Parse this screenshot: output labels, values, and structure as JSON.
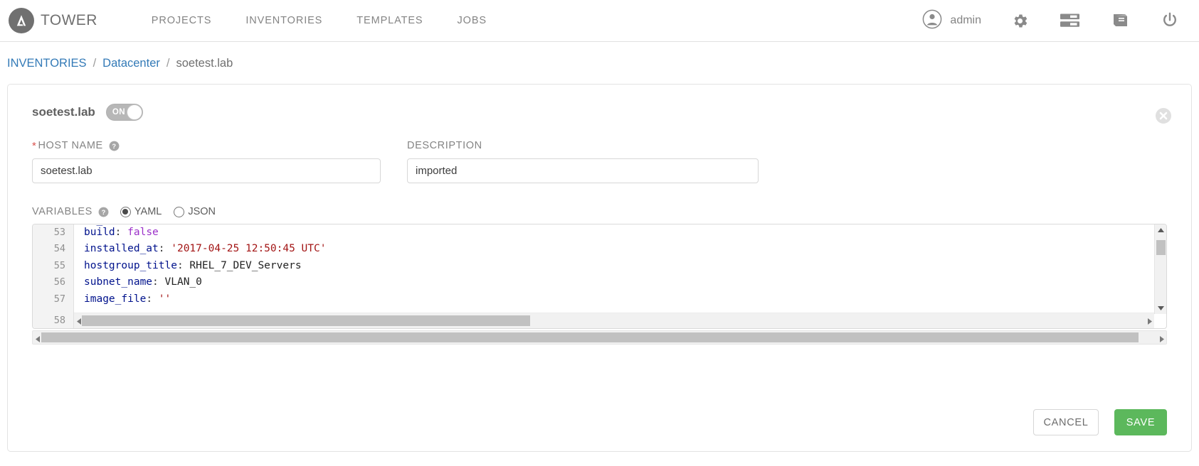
{
  "header": {
    "brand": "TOWER",
    "brand_logo_icon": "tower-a-logo-icon",
    "nav": [
      {
        "label": "PROJECTS",
        "name": "nav-projects"
      },
      {
        "label": "INVENTORIES",
        "name": "nav-inventories"
      },
      {
        "label": "TEMPLATES",
        "name": "nav-templates"
      },
      {
        "label": "JOBS",
        "name": "nav-jobs"
      }
    ],
    "user": "admin",
    "user_icon": "user-avatar-icon",
    "icons": [
      {
        "name": "gear-icon",
        "label": "settings"
      },
      {
        "name": "server-list-icon",
        "label": "inventory-scripts"
      },
      {
        "name": "book-icon",
        "label": "documentation"
      },
      {
        "name": "power-icon",
        "label": "logout"
      }
    ]
  },
  "breadcrumb": {
    "items": [
      {
        "label": "INVENTORIES",
        "link": true
      },
      {
        "label": "Datacenter",
        "link": true
      },
      {
        "label": "soetest.lab",
        "link": false
      }
    ],
    "separator": "/"
  },
  "card": {
    "title": "soetest.lab",
    "toggle": {
      "label": "ON",
      "state": "on"
    },
    "close_icon": "close-circle-icon",
    "fields": {
      "hostname": {
        "label": "HOST NAME",
        "required_marker": "*",
        "help_icon": "question-circle-icon",
        "value": "soetest.lab",
        "placeholder": ""
      },
      "description": {
        "label": "DESCRIPTION",
        "help_icon": "",
        "value": "imported",
        "placeholder": ""
      }
    },
    "variables": {
      "label": "VARIABLES",
      "help_icon": "question-circle-icon",
      "format_options": [
        {
          "label": "YAML",
          "selected": true
        },
        {
          "label": "JSON",
          "selected": false
        }
      ],
      "editor": {
        "clipped_top_line": "",
        "lines": [
          {
            "number": "53",
            "tokens": [
              {
                "t": "build",
                "c": "key"
              },
              {
                "t": ": ",
                "c": "punct"
              },
              {
                "t": "false",
                "c": "bool"
              }
            ]
          },
          {
            "number": "54",
            "tokens": [
              {
                "t": "installed_at",
                "c": "key"
              },
              {
                "t": ": ",
                "c": "punct"
              },
              {
                "t": "'2017-04-25 12:50:45 UTC'",
                "c": "str"
              }
            ]
          },
          {
            "number": "55",
            "tokens": [
              {
                "t": "hostgroup_title",
                "c": "key"
              },
              {
                "t": ": ",
                "c": "punct"
              },
              {
                "t": "RHEL_7_DEV_Servers",
                "c": "plain"
              }
            ]
          },
          {
            "number": "56",
            "tokens": [
              {
                "t": "subnet_name",
                "c": "key"
              },
              {
                "t": ": ",
                "c": "punct"
              },
              {
                "t": "VLAN_0",
                "c": "plain"
              }
            ]
          },
          {
            "number": "57",
            "tokens": [
              {
                "t": "image_file",
                "c": "key"
              },
              {
                "t": ": ",
                "c": "punct"
              },
              {
                "t": "''",
                "c": "str"
              }
            ]
          }
        ],
        "last_line_number": "58"
      }
    },
    "buttons": {
      "cancel": "CANCEL",
      "save": "SAVE"
    }
  },
  "colors": {
    "link": "#337ab7",
    "save_green": "#5cb85c",
    "required_red": "#d9534f",
    "nav_text": "#848484",
    "yaml_key": "#00128c",
    "yaml_bool": "#9b30c9",
    "yaml_string": "#a31515"
  }
}
